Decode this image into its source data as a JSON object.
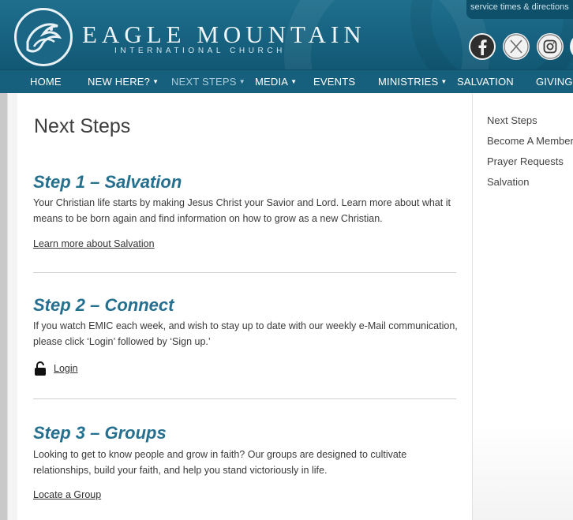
{
  "header": {
    "brand_name": "EAGLE MOUNTAIN",
    "brand_sub": "INTERNATIONAL CHURCH",
    "service_link": "service times & directions"
  },
  "nav": {
    "items": [
      {
        "label": "HOME"
      },
      {
        "label": "NEW HERE?"
      },
      {
        "label": "NEXT STEPS"
      },
      {
        "label": "MEDIA"
      },
      {
        "label": "EVENTS"
      },
      {
        "label": "MINISTRIES"
      },
      {
        "label": "SALVATION"
      },
      {
        "label": "GIVING"
      }
    ],
    "active": "NEXT STEPS",
    "colors": {
      "bar": "#17607d",
      "active_text": "#a9cbd9"
    }
  },
  "social": {
    "icons": [
      "facebook-icon",
      "x-icon",
      "instagram-icon"
    ]
  },
  "main": {
    "page_title": "Next Steps",
    "steps": [
      {
        "title": "Step 1 – Salvation",
        "text": "Your Christian life starts by making Jesus Christ your Savior and Lord.  Learn more about what it means to be born again and find information on how to grow as a new Christian.",
        "link": "Learn more about Salvation"
      },
      {
        "title": "Step 2 – Connect",
        "text": "If you watch EMIC each week, and wish to stay up to date with our weekly e-Mail communication, please click ‘Login’ followed by ‘Sign up.’",
        "link": "Login"
      },
      {
        "title": "Step 3 – Groups",
        "text": "Looking to get to know people and grow in faith?  Our groups are designed to cultivate relationships, build your faith, and help you stand victoriously in life.",
        "link": "Locate a Group"
      }
    ],
    "title_color": "#256f8f"
  },
  "sidebar": {
    "items": [
      {
        "label": "Next Steps"
      },
      {
        "label": "Become A Member"
      },
      {
        "label": "Prayer Requests"
      },
      {
        "label": "Salvation"
      }
    ]
  }
}
